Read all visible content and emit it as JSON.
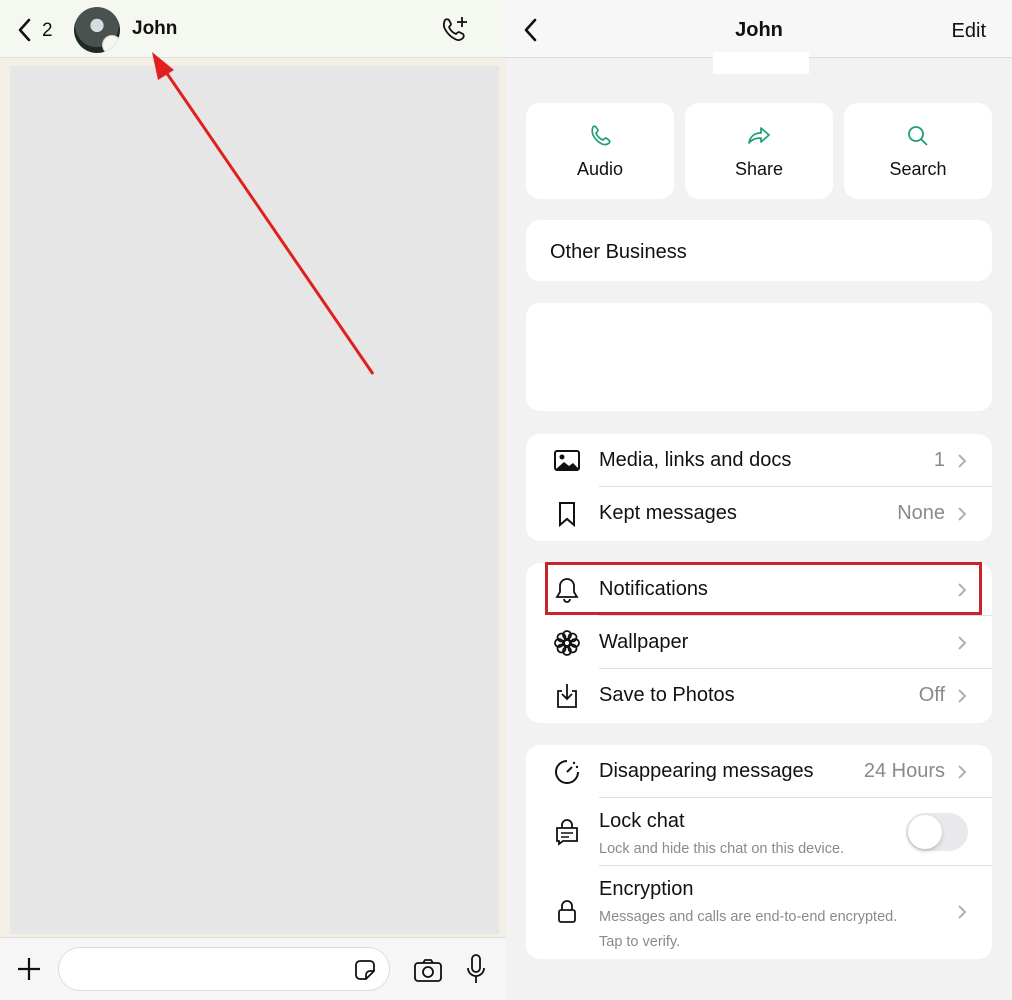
{
  "chat": {
    "back_count": "2",
    "contact_name": "John",
    "icons": {
      "back": "chevron-left-icon",
      "avatar": "contact-avatar",
      "call": "add-call-icon",
      "plus": "plus-icon",
      "sticker": "sticker-icon",
      "camera": "camera-icon",
      "mic": "microphone-icon"
    },
    "message_input": {
      "value": "",
      "placeholder": ""
    }
  },
  "info": {
    "title": "John",
    "edit_label": "Edit",
    "actions": [
      {
        "label": "Audio",
        "icon": "phone-icon"
      },
      {
        "label": "Share",
        "icon": "share-icon"
      },
      {
        "label": "Search",
        "icon": "search-icon"
      }
    ],
    "business_label": "Other Business",
    "group1": [
      {
        "label": "Media, links and docs",
        "value": "1",
        "icon": "image-icon"
      },
      {
        "label": "Kept messages",
        "value": "None",
        "icon": "bookmark-icon"
      }
    ],
    "group2": [
      {
        "label": "Notifications",
        "value": "",
        "icon": "bell-icon"
      },
      {
        "label": "Wallpaper",
        "value": "",
        "icon": "flower-icon"
      },
      {
        "label": "Save to Photos",
        "value": "Off",
        "icon": "download-icon"
      }
    ],
    "group3": {
      "disappearing": {
        "label": "Disappearing messages",
        "value": "24 Hours"
      },
      "lock": {
        "label": "Lock chat",
        "sub": "Lock and hide this chat on this device.",
        "enabled": false
      },
      "encryption": {
        "label": "Encryption",
        "sub1": "Messages and calls are end-to-end encrypted.",
        "sub2": "Tap to verify."
      }
    }
  },
  "annotations": {
    "arrow_color": "#e0201f",
    "highlight_color": "#c9242b",
    "highlighted_item": "Notifications"
  },
  "colors": {
    "accent": "#1f9e6e"
  }
}
